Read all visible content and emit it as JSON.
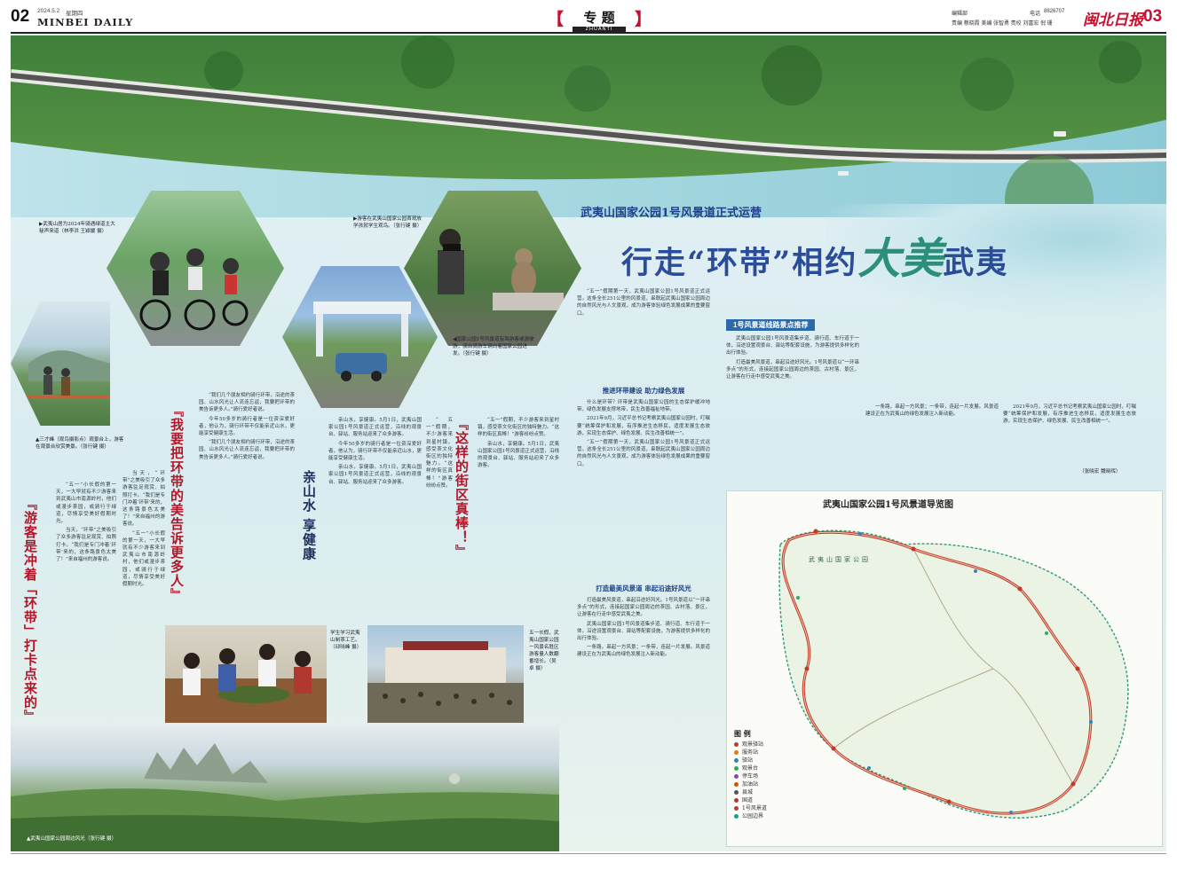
{
  "header": {
    "page_left": "02",
    "date": "2024.5.2",
    "weekday": "星期四",
    "paper_en": "MINBEI DAILY",
    "section": "专 题",
    "section_en": "ZHUANTI",
    "editor_line1": "编辑部",
    "editor_line2": "责编 蔡晓霞   美编 张智勇   责校 刘富宏 倪 珊",
    "phone_label": "电话",
    "phone": "8826707",
    "masthead": "闽北日报",
    "page_right": "03"
  },
  "hero": {
    "kicker": "武夷山国家公园1号风景道正式运营",
    "title_a": "行走“环带”相约",
    "title_b": "大美",
    "title_c": "武夷"
  },
  "captions": {
    "c1": "▶武夷山居为2024年骑遇绿道主大秘声来道（林李洪 王颖媛 摄）",
    "c2": "▶游客在武夷山国家公园首观放学孩就学生观鸟。（张行键 摄）",
    "c3": "◀国家公园1号风景道有驾游客或游驶游，骑自骑游车辆向着国家公园进发。（张行键 摄）",
    "c4": "▲三才峰（观鸟摄影点）观景台上，游客在观景台欣赏美景。（张行键 摄）",
    "c5": "学生学习武夷山制茶工艺。（邱晓峰 摄）",
    "c6": "五一长假，武夷山国家公园一风景名胜区游客量人数翻番增长。（吴卓 摄）",
    "c7": "▲武夷山国家公园周边风光（张行键 摄）"
  },
  "headlines": {
    "v1": "『游客是冲着「环带」打卡点来的』",
    "v2": "『我要把环带的美告诉更多人』",
    "v3": "亲山水 享健康",
    "v4": "『这样的街区真棒！』"
  },
  "article": {
    "box_title": "1号风景道线路景点推荐",
    "sub1": "推进环带建设 助力绿色发展",
    "sub2": "打造最美风景道 串起沿途好风光",
    "end_note": "（张晓宏 魏晓晖）"
  },
  "map": {
    "title": "武夷山国家公园1号风景道导览图",
    "park_label": "武夷山国家公园",
    "legend_title": "图 例",
    "legend": [
      {
        "label": "观景驿站",
        "color": "#c0392b"
      },
      {
        "label": "服务站",
        "color": "#e07b1a"
      },
      {
        "label": "驿站",
        "color": "#2e86c1"
      },
      {
        "label": "观景台",
        "color": "#27ae60"
      },
      {
        "label": "停车场",
        "color": "#8e44ad"
      },
      {
        "label": "加油站",
        "color": "#d35400"
      },
      {
        "label": "县城",
        "color": "#555555"
      },
      {
        "label": "国道",
        "color": "#b03a2e"
      },
      {
        "label": "1号风景道",
        "color": "#c0392b"
      },
      {
        "label": "公园边界",
        "color": "#16a085"
      }
    ]
  },
  "body_text": {
    "p1": "“五一”小长假的第一天，一大早就有不少游客来到武夷山市南源岭村，他们或漫步茶园，或骑行于绿道，尽情享受美好假期时光。",
    "p2": "当天，“环带”之美吸引了众多游客驻足观赏、拍照打卡。“我们是专门冲着‘环带’来的，这条路景色太美了！”来自福州的游客说。",
    "p3": "“我们几个朋友相约骑行环带，沿途的茶园、山水风光让人流连忘返，我要把环带的美告诉更多人。”骑行爱好者说。",
    "p4": "今年50多岁的骑行者是一位资深爱好者，他认为，骑行环带不仅能亲近山水，更能享受健康生活。",
    "p5": "亲山水，享健康。5月1日，武夷山国家公园1号风景道正式运营，沿线的观景台、驿站、服务站迎来了众多游客。",
    "p6": "“五一”假期，不少游客来到星村镇，感受茶文化街区的独特魅力。“这样的街区真棒！”游客纷纷点赞。",
    "p7": "“五一”假期第一天，武夷山国家公园1号风景道正式运营。这条全长251公里的风景道，串联起武夷山国家公园周边的自然风光与人文景观，成为游客体验绿色发展成果的重要窗口。",
    "p8": "什么是环带？环带是武夷山国家公园的生态保护缓冲地带，绿色发展支撑地带，民生改善福祉地带。",
    "p9": "2021年9月，习近平总书记考察武夷山国家公园时，叮嘱要“统筹保护和发展，有序推进生态移民，适度发展生态旅游，实现生态保护、绿色发展、民生改善相统一”。",
    "p10": "打造最美风景道，串起沿途好风光。1号风景道以“一环串多点”的形式，连接起国家公园周边的茶园、古村落、景区，让游客在行走中感受武夷之美。",
    "p11": "武夷山国家公园1号风景道集步道、骑行道、车行道于一体，沿途设置观景台、驿站等配套设施，为游客提供多样化的出行体验。",
    "p12": "一条路，串起一方风景；一条带，连起一片发展。风景道建设正在为武夷山的绿色发展注入新动能。"
  }
}
